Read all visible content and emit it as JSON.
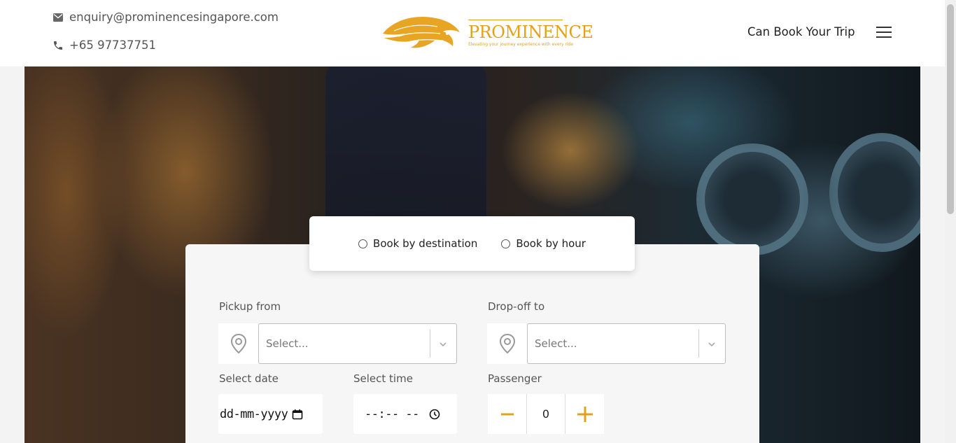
{
  "header": {
    "email": "enquiry@prominencesingapore.com",
    "phone": "+65 97737751",
    "brand_name": "PROMINENCE",
    "brand_tagline": "Elevating your journey experience with every ride",
    "cta_label": "Can Book Your Trip",
    "icons": {
      "email": "mail-icon",
      "phone": "phone-icon",
      "menu": "hamburger-menu-icon",
      "logo": "lion-logo"
    }
  },
  "booking_mode": {
    "options": [
      {
        "label": "Book by destination",
        "selected": false
      },
      {
        "label": "Book by hour",
        "selected": false
      }
    ]
  },
  "form": {
    "pickup": {
      "label": "Pickup from",
      "placeholder": "Select..."
    },
    "dropoff": {
      "label": "Drop-off to",
      "placeholder": "Select..."
    },
    "date": {
      "label": "Select date",
      "value": "dd-mm-yyyy"
    },
    "time": {
      "label": "Select time",
      "value": "--:-- --"
    },
    "passenger": {
      "label": "Passenger",
      "count": "0"
    }
  },
  "colors": {
    "accent": "#e3a11a",
    "text": "#333333",
    "panel": "#f6f6f6"
  }
}
